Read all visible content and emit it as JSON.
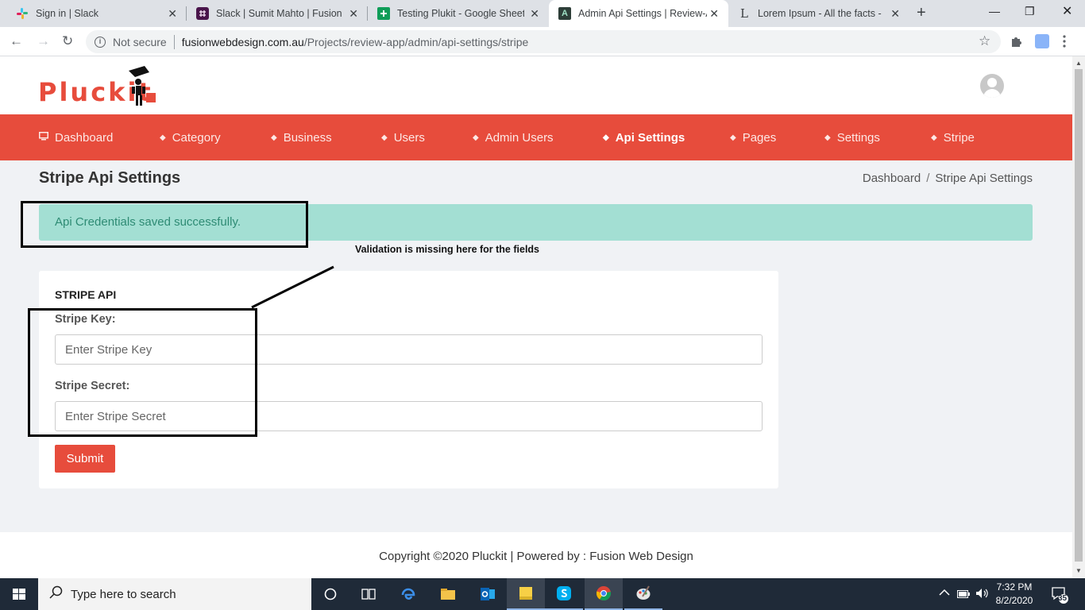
{
  "browser": {
    "tabs": [
      {
        "title": "Sign in | Slack",
        "icon": "slack-icon",
        "active": false
      },
      {
        "title": "Slack | Sumit Mahto | Fusion W",
        "icon": "slack-workspace-icon",
        "active": false
      },
      {
        "title": "Testing Plukit - Google Sheets",
        "icon": "sheets-icon",
        "active": false
      },
      {
        "title": "Admin Api Settings | Review-A",
        "icon": "admin-app-icon",
        "active": true
      },
      {
        "title": "Lorem Ipsum - All the facts - L",
        "icon": "lorem-icon",
        "active": false
      }
    ],
    "security_label": "Not secure",
    "url_host": "fusionwebdesign.com.au",
    "url_path": "/Projects/review-app/admin/api-settings/stripe"
  },
  "site": {
    "logo_text": "Pluckit",
    "nav": [
      {
        "label": "Dashboard",
        "icon": "monitor-icon",
        "active": false
      },
      {
        "label": "Category",
        "icon": "layers-icon",
        "active": false
      },
      {
        "label": "Business",
        "icon": "layers-icon",
        "active": false
      },
      {
        "label": "Users",
        "icon": "layers-icon",
        "active": false
      },
      {
        "label": "Admin Users",
        "icon": "layers-icon",
        "active": false
      },
      {
        "label": "Api Settings",
        "icon": "layers-icon",
        "active": true
      },
      {
        "label": "Pages",
        "icon": "layers-icon",
        "active": false
      },
      {
        "label": "Settings",
        "icon": "layers-icon",
        "active": false
      },
      {
        "label": "Stripe",
        "icon": "layers-icon",
        "active": false
      }
    ],
    "page_title": "Stripe Api Settings",
    "breadcrumb": {
      "home": "Dashboard",
      "separator": "/",
      "current": "Stripe Api Settings"
    },
    "alert": "Api Credentials saved successfully.",
    "form": {
      "section_title": "STRIPE API",
      "key_label": "Stripe Key:",
      "key_placeholder": "Enter Stripe Key",
      "key_value": "",
      "secret_label": "Stripe Secret:",
      "secret_placeholder": "Enter Stripe Secret",
      "secret_value": "",
      "submit_label": "Submit"
    },
    "footer": "Copyright ©2020 Pluckit | Powered by : Fusion Web Design"
  },
  "annotation": {
    "note": "Validation is missing here for the fields"
  },
  "taskbar": {
    "search_placeholder": "Type here to search",
    "time": "7:32 PM",
    "date": "8/2/2020",
    "notification_count": "35"
  },
  "colors": {
    "brand": "#e74c3c",
    "alert_bg": "#a3dfd3",
    "alert_text": "#2e8b74",
    "page_bg": "#f0f2f5"
  }
}
